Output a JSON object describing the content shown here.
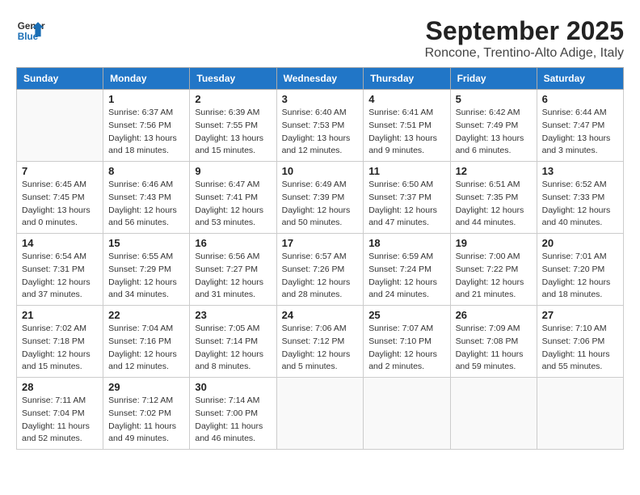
{
  "header": {
    "logo_line1": "General",
    "logo_line2": "Blue",
    "month_title": "September 2025",
    "subtitle": "Roncone, Trentino-Alto Adige, Italy"
  },
  "weekdays": [
    "Sunday",
    "Monday",
    "Tuesday",
    "Wednesday",
    "Thursday",
    "Friday",
    "Saturday"
  ],
  "weeks": [
    [
      {
        "day": "",
        "info": ""
      },
      {
        "day": "1",
        "info": "Sunrise: 6:37 AM\nSunset: 7:56 PM\nDaylight: 13 hours\nand 18 minutes."
      },
      {
        "day": "2",
        "info": "Sunrise: 6:39 AM\nSunset: 7:55 PM\nDaylight: 13 hours\nand 15 minutes."
      },
      {
        "day": "3",
        "info": "Sunrise: 6:40 AM\nSunset: 7:53 PM\nDaylight: 13 hours\nand 12 minutes."
      },
      {
        "day": "4",
        "info": "Sunrise: 6:41 AM\nSunset: 7:51 PM\nDaylight: 13 hours\nand 9 minutes."
      },
      {
        "day": "5",
        "info": "Sunrise: 6:42 AM\nSunset: 7:49 PM\nDaylight: 13 hours\nand 6 minutes."
      },
      {
        "day": "6",
        "info": "Sunrise: 6:44 AM\nSunset: 7:47 PM\nDaylight: 13 hours\nand 3 minutes."
      }
    ],
    [
      {
        "day": "7",
        "info": "Sunrise: 6:45 AM\nSunset: 7:45 PM\nDaylight: 13 hours\nand 0 minutes."
      },
      {
        "day": "8",
        "info": "Sunrise: 6:46 AM\nSunset: 7:43 PM\nDaylight: 12 hours\nand 56 minutes."
      },
      {
        "day": "9",
        "info": "Sunrise: 6:47 AM\nSunset: 7:41 PM\nDaylight: 12 hours\nand 53 minutes."
      },
      {
        "day": "10",
        "info": "Sunrise: 6:49 AM\nSunset: 7:39 PM\nDaylight: 12 hours\nand 50 minutes."
      },
      {
        "day": "11",
        "info": "Sunrise: 6:50 AM\nSunset: 7:37 PM\nDaylight: 12 hours\nand 47 minutes."
      },
      {
        "day": "12",
        "info": "Sunrise: 6:51 AM\nSunset: 7:35 PM\nDaylight: 12 hours\nand 44 minutes."
      },
      {
        "day": "13",
        "info": "Sunrise: 6:52 AM\nSunset: 7:33 PM\nDaylight: 12 hours\nand 40 minutes."
      }
    ],
    [
      {
        "day": "14",
        "info": "Sunrise: 6:54 AM\nSunset: 7:31 PM\nDaylight: 12 hours\nand 37 minutes."
      },
      {
        "day": "15",
        "info": "Sunrise: 6:55 AM\nSunset: 7:29 PM\nDaylight: 12 hours\nand 34 minutes."
      },
      {
        "day": "16",
        "info": "Sunrise: 6:56 AM\nSunset: 7:27 PM\nDaylight: 12 hours\nand 31 minutes."
      },
      {
        "day": "17",
        "info": "Sunrise: 6:57 AM\nSunset: 7:26 PM\nDaylight: 12 hours\nand 28 minutes."
      },
      {
        "day": "18",
        "info": "Sunrise: 6:59 AM\nSunset: 7:24 PM\nDaylight: 12 hours\nand 24 minutes."
      },
      {
        "day": "19",
        "info": "Sunrise: 7:00 AM\nSunset: 7:22 PM\nDaylight: 12 hours\nand 21 minutes."
      },
      {
        "day": "20",
        "info": "Sunrise: 7:01 AM\nSunset: 7:20 PM\nDaylight: 12 hours\nand 18 minutes."
      }
    ],
    [
      {
        "day": "21",
        "info": "Sunrise: 7:02 AM\nSunset: 7:18 PM\nDaylight: 12 hours\nand 15 minutes."
      },
      {
        "day": "22",
        "info": "Sunrise: 7:04 AM\nSunset: 7:16 PM\nDaylight: 12 hours\nand 12 minutes."
      },
      {
        "day": "23",
        "info": "Sunrise: 7:05 AM\nSunset: 7:14 PM\nDaylight: 12 hours\nand 8 minutes."
      },
      {
        "day": "24",
        "info": "Sunrise: 7:06 AM\nSunset: 7:12 PM\nDaylight: 12 hours\nand 5 minutes."
      },
      {
        "day": "25",
        "info": "Sunrise: 7:07 AM\nSunset: 7:10 PM\nDaylight: 12 hours\nand 2 minutes."
      },
      {
        "day": "26",
        "info": "Sunrise: 7:09 AM\nSunset: 7:08 PM\nDaylight: 11 hours\nand 59 minutes."
      },
      {
        "day": "27",
        "info": "Sunrise: 7:10 AM\nSunset: 7:06 PM\nDaylight: 11 hours\nand 55 minutes."
      }
    ],
    [
      {
        "day": "28",
        "info": "Sunrise: 7:11 AM\nSunset: 7:04 PM\nDaylight: 11 hours\nand 52 minutes."
      },
      {
        "day": "29",
        "info": "Sunrise: 7:12 AM\nSunset: 7:02 PM\nDaylight: 11 hours\nand 49 minutes."
      },
      {
        "day": "30",
        "info": "Sunrise: 7:14 AM\nSunset: 7:00 PM\nDaylight: 11 hours\nand 46 minutes."
      },
      {
        "day": "",
        "info": ""
      },
      {
        "day": "",
        "info": ""
      },
      {
        "day": "",
        "info": ""
      },
      {
        "day": "",
        "info": ""
      }
    ]
  ]
}
